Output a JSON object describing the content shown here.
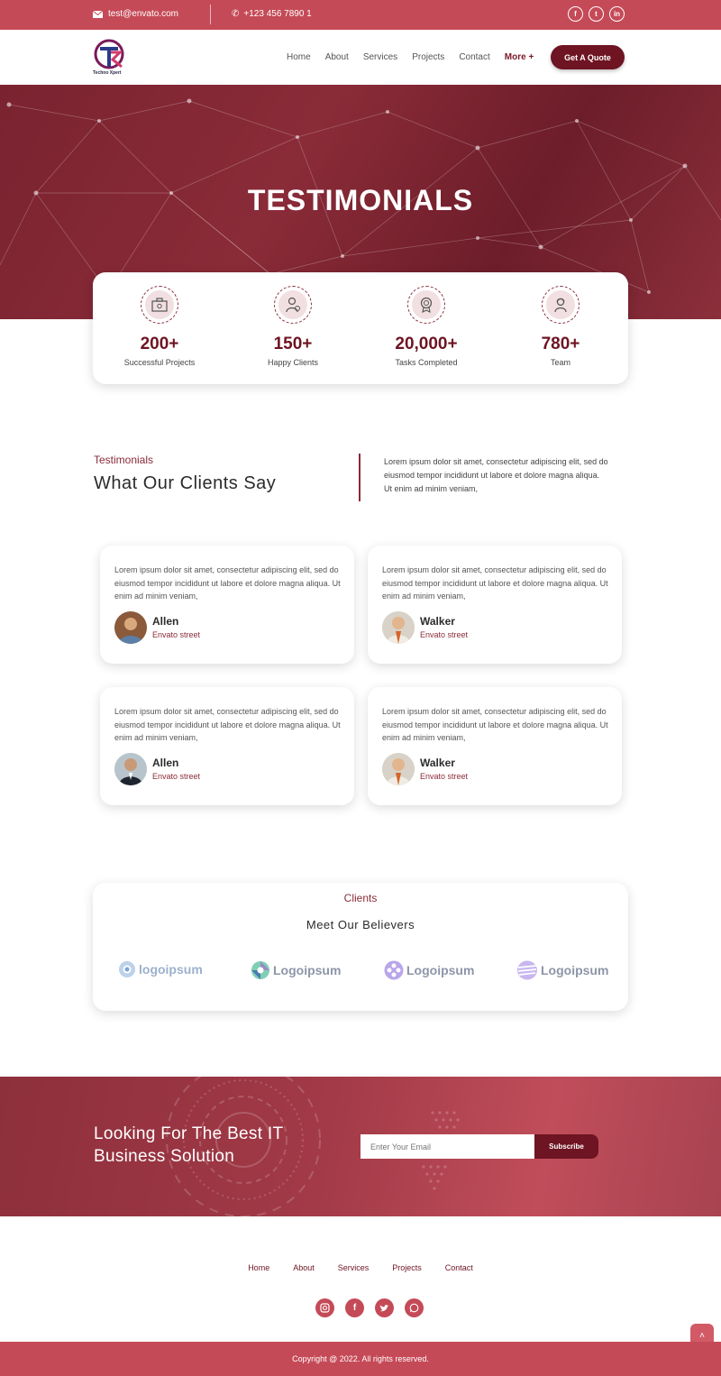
{
  "topbar": {
    "email": "test@envato.com",
    "phone": "+123 456 7890 1",
    "socials": [
      "facebook-icon",
      "twitter-icon",
      "linkedin-icon"
    ]
  },
  "brand": {
    "logo_text": "Techno Xpert"
  },
  "nav": {
    "items": [
      "Home",
      "About",
      "Services",
      "Projects",
      "Contact"
    ],
    "more": "More +",
    "cta": "Get A Quote"
  },
  "hero": {
    "title": "TESTIMONIALS"
  },
  "stats": [
    {
      "value": "200+",
      "label": "Successful Projects",
      "icon": "briefcase-icon"
    },
    {
      "value": "150+",
      "label": "Happy Clients",
      "icon": "client-icon"
    },
    {
      "value": "20,000+",
      "label": "Tasks Completed",
      "icon": "award-icon"
    },
    {
      "value": "780+",
      "label": "Team",
      "icon": "team-icon"
    }
  ],
  "testimonials_section": {
    "eyebrow": "Testimonials",
    "title": "What Our Clients Say",
    "description": "Lorem ipsum dolor sit amet, consectetur adipiscing elit, sed do eiusmod tempor incididunt ut labore et dolore magna aliqua. Ut enim ad minim veniam,"
  },
  "testimonials": [
    {
      "text": "Lorem ipsum dolor sit amet, consectetur adipiscing elit, sed do eiusmod tempor incididunt ut labore et dolore magna aliqua. Ut enim ad minim veniam,",
      "name": "Allen",
      "street": "Envato street"
    },
    {
      "text": "Lorem ipsum dolor sit amet, consectetur adipiscing elit, sed do eiusmod tempor incididunt ut labore et dolore magna aliqua. Ut enim ad minim veniam,",
      "name": "Walker",
      "street": "Envato street"
    },
    {
      "text": "Lorem ipsum dolor sit amet, consectetur adipiscing elit, sed do eiusmod tempor incididunt ut labore et dolore magna aliqua. Ut enim ad minim veniam,",
      "name": "Allen",
      "street": "Envato street"
    },
    {
      "text": "Lorem ipsum dolor sit amet, consectetur adipiscing elit, sed do eiusmod tempor incididunt ut labore et dolore magna aliqua. Ut enim ad minim veniam,",
      "name": "Walker",
      "street": "Envato street"
    }
  ],
  "clients": {
    "eyebrow": "Clients",
    "title": "Meet Our Believers",
    "logos": [
      "logoipsum",
      "Logoipsum",
      "Logoipsum",
      "Logoipsum"
    ]
  },
  "cta": {
    "title": "Looking For The Best IT Business Solution",
    "input_placeholder": "Enter Your Email",
    "button": "Subscribe"
  },
  "footer": {
    "nav": [
      "Home",
      "About",
      "Services",
      "Projects",
      "Contact"
    ],
    "socials": [
      "instagram-icon",
      "facebook-icon",
      "twitter-icon",
      "whatsapp-icon"
    ],
    "copyright": "Copyright @ 2022. All rights reserved."
  },
  "colors": {
    "primary": "#c54a57",
    "dark": "#6e1422",
    "accent": "#8a2b38"
  }
}
